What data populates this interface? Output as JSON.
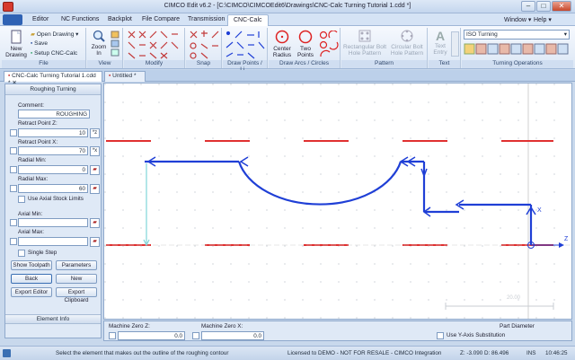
{
  "window": {
    "title": "CIMCO Edit v6.2 - [C:\\CIMCO\\CIMCOEdit6\\Drawings\\CNC-Calc Turning Tutorial 1.cdd *]",
    "min": "–",
    "max": "□",
    "close": "✕"
  },
  "menu_tabs": [
    "Editor",
    "NC Functions",
    "Backplot",
    "File Compare",
    "Transmission",
    "CNC-Calc"
  ],
  "active_tab": "CNC-Calc",
  "window_menu": "Window ▾",
  "help_menu": "Help ▾",
  "ribbon": {
    "file": {
      "label": "File",
      "new_drawing": "New\nDrawing",
      "open_drawing": "Open Drawing ▾",
      "save": "Save",
      "setup": "Setup CNC-Calc"
    },
    "view": {
      "label": "View",
      "zoom_in": "Zoom\nIn"
    },
    "modify": {
      "label": "Modify"
    },
    "snap": {
      "label": "Snap"
    },
    "draw_points": {
      "label": "Draw Points / Li..."
    },
    "draw_arcs": {
      "label": "Draw Arcs / Circles",
      "center_radius": "Center\nRadius",
      "two_points": "Two\nPoints"
    },
    "pattern": {
      "label": "Pattern",
      "rect_bolt": "Rectangular Bolt\nHole Pattern",
      "circ_bolt": "Circular Bolt\nHole Pattern"
    },
    "text": {
      "label": "Text",
      "text_entry": "Text\nEntry"
    },
    "turning": {
      "label": "Turning Operations",
      "select_value": "ISO Turning"
    }
  },
  "doc_tabs": [
    "CNC-Calc Turning Tutorial 1.cdd *",
    "Untitled *"
  ],
  "panel": {
    "title": "Roughing Turning",
    "comment_label": "Comment:",
    "comment_value": "ROUGHING",
    "retract_z_label": "Retract Point Z:",
    "retract_z_value": "10",
    "retract_x_label": "Retract Point X:",
    "retract_x_value": "70",
    "radial_min_label": "Radial Min:",
    "radial_min_value": "0",
    "radial_max_label": "Radial Max:",
    "radial_max_value": "60",
    "axial_stock_label": "Use Axial Stock Limits",
    "axial_min_label": "Axial Min:",
    "axial_max_label": "Axial Max:",
    "single_step_label": "Single Step",
    "show_toolpath": "Show Toolpath",
    "parameters": "Parameters",
    "back": "Back",
    "new": "New",
    "export_editor": "Export Editor",
    "export_clipboard": "Export Clipboard",
    "element_info": "Element Info",
    "z_sub": "*z",
    "x_sub": "*x"
  },
  "canvas": {
    "axis_x": "X",
    "axis_z": "Z",
    "scale_label": "20.00"
  },
  "bottom": {
    "machine_zero_z_label": "Machine Zero Z:",
    "machine_zero_z_value": "0.0",
    "machine_zero_x_label": "Machine Zero X:",
    "machine_zero_x_value": "0.0",
    "part_diameter_label": "Part Diameter",
    "y_axis_label": "Use Y-Axis Substitution"
  },
  "status": {
    "message": "Select the element that makes out the outline of the roughing contour",
    "license": "Licensed to DEMO - NOT FOR RESALE - CIMCO Integration",
    "coords": "Z: -3.090  D: 86.496",
    "ins": "INS",
    "time": "10:46:25"
  },
  "colors": {
    "accent": "#1f3fd6",
    "stock": "#e03030",
    "ribbon_bg": "#dce7f5"
  }
}
